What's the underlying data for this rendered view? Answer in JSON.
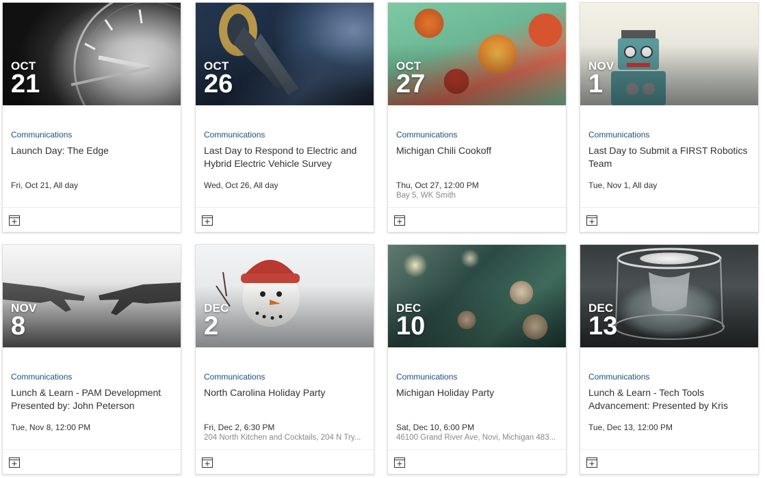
{
  "events": [
    {
      "month": "OCT",
      "day": "21",
      "category": "Communications",
      "title": "Launch Day: The Edge",
      "when": "Fri, Oct 21, All day",
      "where": "",
      "image": "wristwatch-closeup"
    },
    {
      "month": "OCT",
      "day": "26",
      "category": "Communications",
      "title": "Last Day to Respond to Electric and Hybrid Electric Vehicle Survey",
      "when": "Wed, Oct 26, All day",
      "where": "",
      "image": "ev-charging-plug"
    },
    {
      "month": "OCT",
      "day": "27",
      "category": "Communications",
      "title": "Michigan Chili Cookoff",
      "when": "Thu, Oct 27, 12:00 PM",
      "where": "Bay 5, WK Smith",
      "image": "mexican-food-spread"
    },
    {
      "month": "NOV",
      "day": "1",
      "category": "Communications",
      "title": "Last Day to Submit a FIRST Robotics Team",
      "when": "Tue, Nov 1, All day",
      "where": "",
      "image": "toy-robot"
    },
    {
      "month": "NOV",
      "day": "8",
      "category": "Communications",
      "title": "Lunch & Learn - PAM Development Presented by: John Peterson",
      "when": "Tue, Nov 8, 12:00 PM",
      "where": "",
      "image": "robot-hands"
    },
    {
      "month": "DEC",
      "day": "2",
      "category": "Communications",
      "title": "North Carolina Holiday Party",
      "when": "Fri, Dec 2, 6:30 PM",
      "where": "204 North Kitchen and Cocktails, 204 N Try...",
      "image": "snowman"
    },
    {
      "month": "DEC",
      "day": "10",
      "category": "Communications",
      "title": "Michigan Holiday Party",
      "when": "Sat, Dec 10, 6:00 PM",
      "where": "46100 Grand River Ave, Novi, Michigan 483...",
      "image": "pine-cones"
    },
    {
      "month": "DEC",
      "day": "13",
      "category": "Communications",
      "title": "Lunch & Learn - Tech Tools Advancement: Presented by Kris",
      "when": "Tue, Dec 13, 12:00 PM",
      "where": "",
      "image": "sci-fi-pod"
    }
  ],
  "icons": {
    "add_to_calendar": "calendar-add-icon"
  },
  "colors": {
    "category_text": "#1f4e79",
    "title_text": "#323130",
    "location_text": "#8a8886",
    "card_border": "#e1dfdd"
  }
}
